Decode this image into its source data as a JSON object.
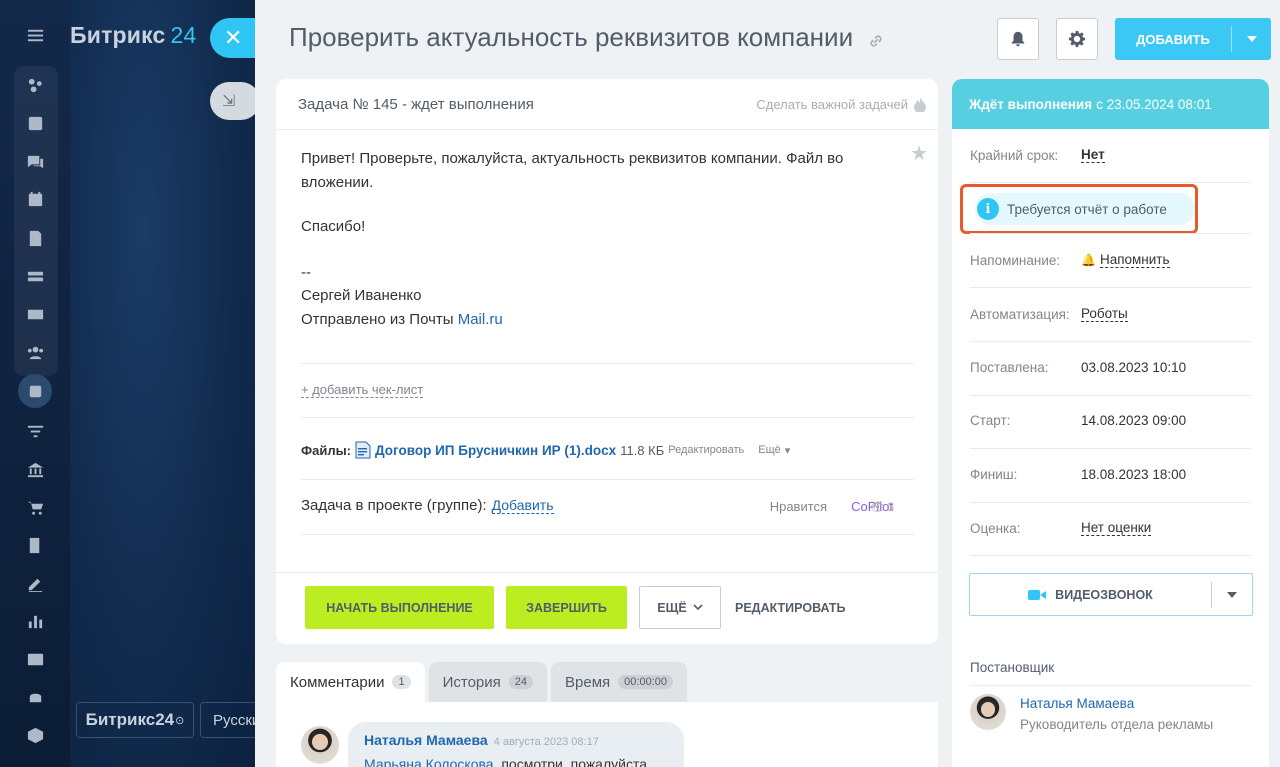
{
  "brand": {
    "name": "Битрикс",
    "number": "24",
    "badge": "Битрикс24",
    "lang": "Русский"
  },
  "icons": {
    "nav": [
      "menu-icon",
      "feed-icon",
      "calendar-list-icon",
      "chat-icon",
      "calendar-icon",
      "document-icon",
      "drive-icon",
      "mail-icon",
      "users-icon",
      "tasks-icon",
      "filter-icon",
      "bank-icon",
      "cart-icon",
      "form-icon",
      "sign-icon",
      "chart-icon",
      "contact-card-icon",
      "android-icon",
      "box-icon"
    ]
  },
  "task": {
    "title": "Проверить актуальность реквизитов компании",
    "header": "Задача № 145 - ждет выполнения",
    "make_important": "Сделать важной задачей",
    "description": {
      "line1": "Привет! Проверьте, пожалуйста, актуальность реквизитов компании. Файл во вложении.",
      "line2": "Спасибо!",
      "line3": "--",
      "line4": "Сергей Иваненко",
      "line5_prefix": "Отправлено из Почты ",
      "line5_link": "Mail.ru"
    },
    "checklist": "+ добавить чек-лист",
    "files_label": "Файлы:",
    "file_name": "Договор ИП Брусничкин ИР (1).docx",
    "file_size": "11.8 КБ",
    "file_edit": "Редактировать",
    "file_more": "Ещё",
    "project_label": "Задача в проекте (группе):",
    "project_add": "Добавить",
    "like": "Нравится",
    "copilot": "CoPilot",
    "views": "3"
  },
  "toolbar": {
    "add_label": "ДОБАВИТЬ"
  },
  "actions": {
    "start": "НАЧАТЬ ВЫПОЛНЕНИЕ",
    "complete": "ЗАВЕРШИТЬ",
    "more": "ЕЩЁ",
    "edit": "РЕДАКТИРОВАТЬ"
  },
  "tabs": [
    {
      "label": "Комментарии",
      "count": "1"
    },
    {
      "label": "История",
      "count": "24"
    },
    {
      "label": "Время",
      "count": "00:00:00"
    }
  ],
  "comment": {
    "author": "Наталья Мамаева",
    "date": "4 августа 2023 08:17",
    "mention": "Марьяна Колоскова",
    "text": ", посмотри, пожалуйста"
  },
  "sidebar": {
    "status_bold": "Ждёт выполнения",
    "status_rest": "с 23.05.2024 08:01",
    "deadline_label": "Крайний срок:",
    "deadline_value": "Нет",
    "report": "Требуется отчёт о работе",
    "reminder_label": "Напоминание:",
    "reminder_value": "Напомнить",
    "automation_label": "Автоматизация:",
    "automation_value": "Роботы",
    "created_label": "Поставлена:",
    "created_value": "03.08.2023 10:10",
    "start_label": "Старт:",
    "start_value": "14.08.2023 09:00",
    "finish_label": "Финиш:",
    "finish_value": "18.08.2023 18:00",
    "rating_label": "Оценка:",
    "rating_value": "Нет оценки",
    "video_call": "ВИДЕОЗВОНОК",
    "creator_title": "Постановщик",
    "creator_name": "Наталья Мамаева",
    "creator_role": "Руководитель отдела рекламы"
  },
  "colors": {
    "accent": "#2fc6f6",
    "green": "#bbed21",
    "status": "#56d0e0",
    "highlight": "#e85a2c"
  }
}
